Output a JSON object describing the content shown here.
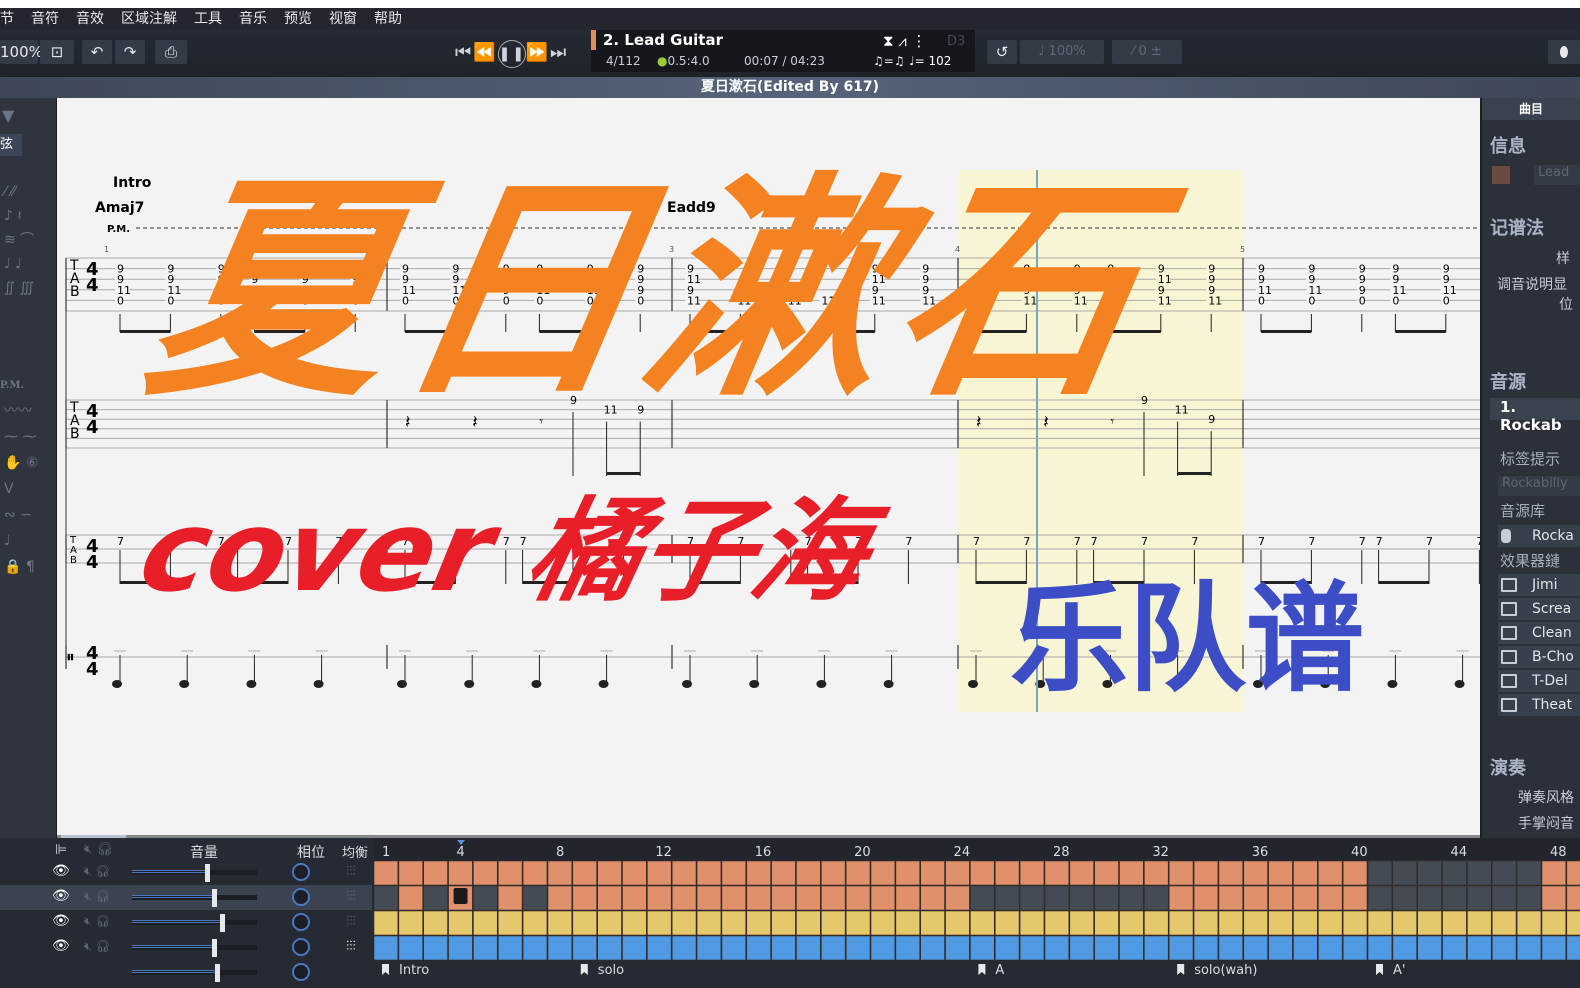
{
  "menu": [
    "小节",
    "音符",
    "音效",
    "区域注解",
    "工具",
    "音乐",
    "预览",
    "视窗",
    "帮助"
  ],
  "toolbar": {
    "zoom": "100%",
    "undo_icon": "undo-icon",
    "redo_icon": "redo-icon",
    "print_icon": "print-icon"
  },
  "transport": {
    "track": "2. Lead Guitar",
    "bar": "4/112",
    "beat": "0.5:4.0",
    "time": "00:07 / 04:23",
    "tempo": "♩= 102",
    "swing": "♫=♫",
    "key": "D3",
    "speed": "100%",
    "pitch": "0"
  },
  "title": "夏日漱石(Edited By 617)",
  "left": {
    "string_label": "弦",
    "pm": "P.M."
  },
  "score": {
    "section": "Intro",
    "chords": [
      "Amaj7",
      "Eadd9"
    ],
    "pm": "P.M.",
    "measure_numbers": [
      "1",
      "2",
      "3",
      "4",
      "5"
    ],
    "lead": [
      [
        {
          "p": 0,
          "f": [
            "9",
            "9",
            "11",
            "0"
          ]
        },
        {
          "p": 3,
          "f": [
            "9",
            "9",
            "11",
            "0"
          ]
        },
        {
          "p": 6,
          "f": [
            "9",
            "9",
            "9",
            "0"
          ]
        },
        {
          "p": 8,
          "f": [
            "9",
            "9",
            "11",
            "0"
          ]
        },
        {
          "p": 11,
          "f": [
            "9",
            "9",
            "11",
            "0"
          ]
        },
        {
          "p": 14,
          "f": [
            "9",
            "9",
            "9",
            "0"
          ]
        }
      ],
      [
        {
          "p": 0,
          "f": [
            "9",
            "9",
            "11",
            "0"
          ]
        },
        {
          "p": 3,
          "f": [
            "9",
            "9",
            "11",
            "0"
          ]
        },
        {
          "p": 6,
          "f": [
            "9",
            "9",
            "9",
            "0"
          ]
        },
        {
          "p": 8,
          "f": [
            "9",
            "9",
            "11",
            "0"
          ]
        },
        {
          "p": 11,
          "f": [
            "9",
            "9",
            "11",
            "0"
          ]
        },
        {
          "p": 14,
          "f": [
            "9",
            "9",
            "9",
            "0"
          ]
        }
      ],
      [
        {
          "p": 0,
          "f": [
            "9",
            "11",
            "9",
            "11"
          ]
        },
        {
          "p": 3,
          "f": [
            "",
            "",
            "",
            "11"
          ]
        },
        {
          "p": 6,
          "f": [
            "",
            "",
            "",
            "11"
          ]
        },
        {
          "p": 8,
          "f": [
            "",
            "",
            "",
            "11"
          ]
        },
        {
          "p": 11,
          "f": [
            "9",
            "11",
            "9",
            "11"
          ]
        },
        {
          "p": 14,
          "f": [
            "9",
            "9",
            "9",
            "11"
          ]
        }
      ],
      [
        {
          "p": 0,
          "f": [
            "",
            "",
            "",
            "11"
          ]
        },
        {
          "p": 3,
          "f": [
            "9",
            "11",
            "9",
            "11"
          ]
        },
        {
          "p": 6,
          "f": [
            "9",
            "9",
            "9",
            "11"
          ]
        },
        {
          "p": 8,
          "f": [
            "9",
            "11",
            "9",
            "11"
          ]
        },
        {
          "p": 11,
          "f": [
            "9",
            "11",
            "9",
            "11"
          ]
        },
        {
          "p": 14,
          "f": [
            "9",
            "9",
            "9",
            "11"
          ]
        }
      ],
      [
        {
          "p": 0,
          "f": [
            "9",
            "9",
            "11",
            "0"
          ]
        },
        {
          "p": 3,
          "f": [
            "9",
            "9",
            "11",
            "0"
          ]
        },
        {
          "p": 6,
          "f": [
            "9",
            "9",
            "9",
            "0"
          ]
        },
        {
          "p": 8,
          "f": [
            "9",
            "9",
            "11",
            "0"
          ]
        },
        {
          "p": 11,
          "f": [
            "9",
            "9",
            "11",
            "0"
          ]
        }
      ]
    ],
    "rhythm": [
      [],
      [
        {
          "p": 10,
          "s": 0,
          "f": "9"
        },
        {
          "p": 12,
          "s": 1,
          "f": "11"
        },
        {
          "p": 14,
          "s": 1,
          "f": "9"
        }
      ],
      [],
      [
        {
          "p": 10,
          "s": 0,
          "f": "9"
        },
        {
          "p": 12,
          "s": 1,
          "f": "11"
        },
        {
          "p": 14,
          "s": 2,
          "f": "9"
        }
      ],
      []
    ],
    "bass": [
      [
        "0",
        "3",
        "6",
        "7",
        "10",
        "13"
      ],
      [
        "0",
        "3",
        "6",
        "7",
        "10",
        "13"
      ],
      [
        "0",
        "3",
        "6",
        "7",
        "10",
        "13"
      ],
      [
        "0",
        "3",
        "6",
        "7",
        "10",
        "13"
      ],
      [
        "0",
        "3",
        "6",
        "7",
        "10",
        "13"
      ]
    ],
    "bass_fret": "7"
  },
  "overlay": {
    "title": "夏日漱石",
    "cover": "cover 橘子海",
    "band": "乐队谱",
    "colors": {
      "title": "#f58220",
      "cover": "#e81e28",
      "band": "#3d4dc6"
    }
  },
  "right": {
    "tab": "曲目",
    "info": "信息",
    "info_field": "Lead",
    "notation": "记谱法",
    "n1": "样",
    "n2": "调音说明显",
    "n3": "位",
    "sound": "音源",
    "sound_item": "1. Rockab",
    "tag": "标签提示",
    "tag_placeholder": "Rockabilly",
    "bank": "音源库",
    "bank_item": "Rocka",
    "chain": "效果器鏈",
    "effects": [
      "Jimi",
      "Screa",
      "Clean",
      "B-Cho",
      "T-Del",
      "Theat"
    ],
    "play": "演奏",
    "p1": "弹奏风格",
    "p2": "手掌闷音"
  },
  "mixer": {
    "volume": "音量",
    "pan": "相位",
    "eq": "均衡"
  },
  "timeline": {
    "numbers": [
      "1",
      "4",
      "8",
      "12",
      "16",
      "20",
      "24",
      "28",
      "32",
      "36",
      "40",
      "44",
      "48"
    ],
    "tracks": [
      {
        "color": "#e0906a",
        "empty": [
          41,
          42,
          43,
          44,
          45,
          46,
          47
        ]
      },
      {
        "color": "#e0906a",
        "empty": [
          1,
          3,
          5,
          7,
          25,
          26,
          27,
          28,
          29,
          30,
          31,
          32,
          41,
          42,
          43,
          44,
          45,
          46,
          47
        ]
      },
      {
        "color": "#e6c86c",
        "empty": []
      },
      {
        "color": "#4f9ae2",
        "empty": []
      }
    ],
    "markers": [
      {
        "bar": 1,
        "label": "Intro"
      },
      {
        "bar": 9,
        "label": "solo"
      },
      {
        "bar": 25,
        "label": "A"
      },
      {
        "bar": 33,
        "label": "solo(wah)"
      },
      {
        "bar": 41,
        "label": "A'"
      }
    ]
  }
}
